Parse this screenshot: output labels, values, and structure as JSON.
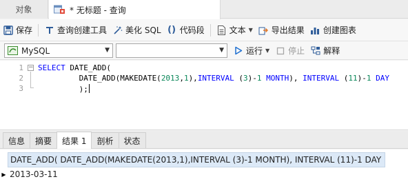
{
  "tabs": {
    "objects_label": "对象",
    "query_label": "* 无标题 - 查询"
  },
  "toolbar": {
    "save": "保存",
    "query_builder": "查询创建工具",
    "beautify_sql": "美化 SQL",
    "code_snippet": "代码段",
    "text": "文本",
    "export_result": "导出结果",
    "create_chart": "创建图表"
  },
  "connection": {
    "db_type": "MySQL",
    "database": "",
    "run": "运行",
    "stop": "停止",
    "explain": "解释"
  },
  "editor": {
    "line_numbers": [
      "1",
      "2",
      "3"
    ]
  },
  "bottom_tabs": {
    "info": "信息",
    "summary": "摘要",
    "result1": "结果 1",
    "profile": "剖析",
    "status": "状态"
  },
  "result": {
    "column_header": "DATE_ADD(  DATE_ADD(MAKEDATE(2013,1),INTERVAL (3)-1 MONTH), INTERVAL (11)-1 DAY  )",
    "rows": [
      "2013-03-11"
    ]
  },
  "colors": {
    "keyword": "#0000ff",
    "number": "#098658",
    "header_bg": "#dce9f7",
    "accent_blue": "#1e6fd0"
  }
}
